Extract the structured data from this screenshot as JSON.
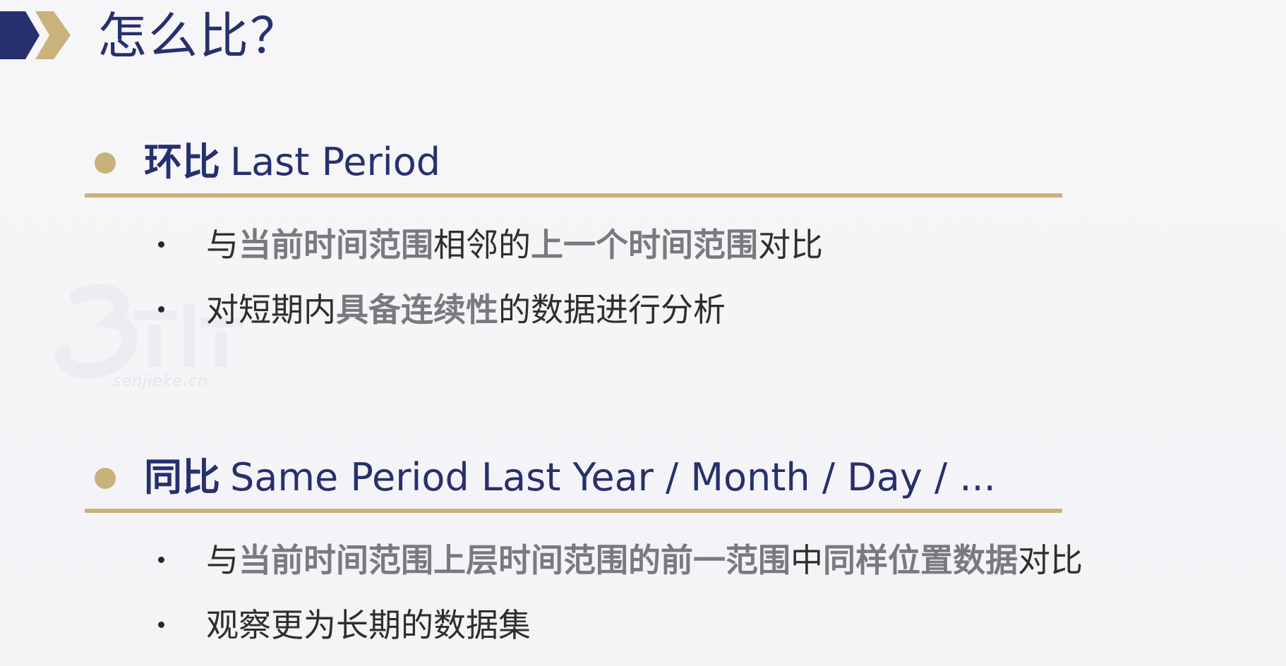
{
  "title": "怎么比？",
  "colors": {
    "navy": "#27306e",
    "gold": "#c9b27c",
    "text": "#2e2e2e",
    "highlight": "#7a7a7e"
  },
  "watermark": {
    "text": "senjieke.cn"
  },
  "sections": [
    {
      "title_cn": "环比",
      "title_en": "Last Period",
      "bullets": [
        {
          "parts": [
            {
              "text": "与",
              "hl": false
            },
            {
              "text": "当前时间范围",
              "hl": true
            },
            {
              "text": "相邻的",
              "hl": false
            },
            {
              "text": "上一个时间范围",
              "hl": true
            },
            {
              "text": "对比",
              "hl": false
            }
          ]
        },
        {
          "parts": [
            {
              "text": "对短期内",
              "hl": false
            },
            {
              "text": "具备连续性",
              "hl": true
            },
            {
              "text": "的数据进行分析",
              "hl": false
            }
          ]
        }
      ]
    },
    {
      "title_cn": "同比",
      "title_en": "Same Period Last Year / Month / Day / ...",
      "bullets": [
        {
          "parts": [
            {
              "text": "与",
              "hl": false
            },
            {
              "text": "当前时间范围上层时间范围的前一范围",
              "hl": true
            },
            {
              "text": "中",
              "hl": false
            },
            {
              "text": "同样位置数据",
              "hl": true
            },
            {
              "text": "对比",
              "hl": false
            }
          ]
        },
        {
          "parts": [
            {
              "text": "观察更为长期的数据集",
              "hl": false
            }
          ]
        }
      ]
    }
  ]
}
